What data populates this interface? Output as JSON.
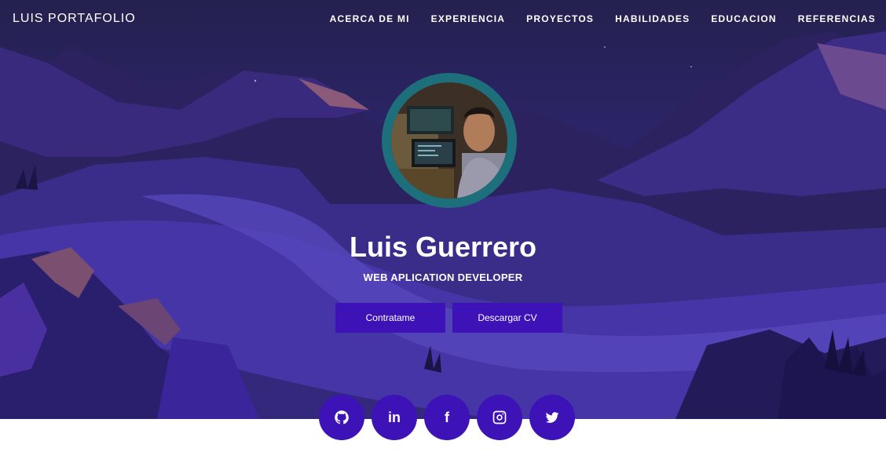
{
  "navbar": {
    "brand": "LUIS PORTAFOLIO",
    "links": [
      "ACERCA DE MI",
      "EXPERIENCIA",
      "PROYECTOS",
      "HABILIDADES",
      "EDUCACION",
      "REFERENCIAS"
    ]
  },
  "hero": {
    "name": "Luis Guerrero",
    "role": "WEB APLICATION DEVELOPER",
    "buttons": {
      "hire": "Contratame",
      "cv": "Descargar CV"
    }
  },
  "socials": [
    {
      "icon": "github-icon"
    },
    {
      "icon": "linkedin-icon",
      "glyph": "in"
    },
    {
      "icon": "facebook-icon",
      "glyph": "f"
    },
    {
      "icon": "instagram-icon"
    },
    {
      "icon": "twitter-icon"
    }
  ],
  "colors": {
    "accent": "#3d13b8",
    "avatar_ring": "#1e6f7c",
    "hero_bg": "#2b2466"
  }
}
